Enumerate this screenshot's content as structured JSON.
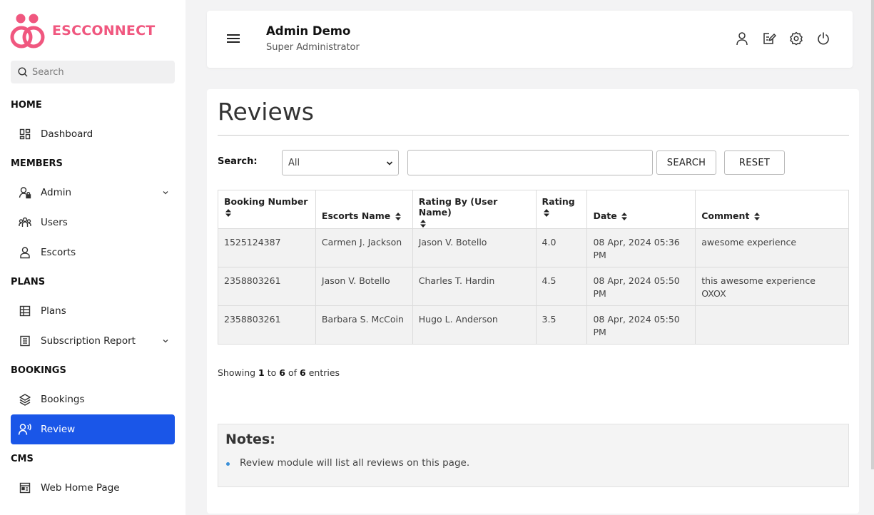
{
  "brand": {
    "name": "ESCCONNECT",
    "color": "#f0577f"
  },
  "sidebar": {
    "search_placeholder": "Search",
    "sections": {
      "home": "HOME",
      "members": "MEMBERS",
      "plans": "PLANS",
      "bookings": "BOOKINGS",
      "cms": "CMS"
    },
    "items": {
      "dashboard": "Dashboard",
      "admin": "Admin",
      "users": "Users",
      "escorts": "Escorts",
      "plans": "Plans",
      "subscription_report": "Subscription Report",
      "bookings": "Bookings",
      "review": "Review",
      "web_home_page": "Web Home Page"
    },
    "active_item": "Review",
    "active_color": "#1a56e8"
  },
  "header": {
    "user_name": "Admin Demo",
    "user_role": "Super Administrator",
    "icons": [
      "user-icon",
      "edit-icon",
      "settings-icon",
      "power-icon"
    ]
  },
  "page": {
    "title": "Reviews",
    "filter": {
      "label": "Search:",
      "select_value": "All",
      "input_value": "",
      "search_button": "SEARCH",
      "reset_button": "RESET"
    },
    "table": {
      "headers": [
        "Booking Number",
        "Escorts Name",
        "Rating By (User Name)",
        "Rating",
        "Date",
        "Comment"
      ],
      "rows": [
        [
          "1525124387",
          "Carmen J. Jackson",
          "Jason V. Botello",
          "4.0",
          "08 Apr, 2024 05:36 PM",
          "awesome experience"
        ],
        [
          "2358803261",
          "Jason V. Botello",
          "Charles T. Hardin",
          "4.5",
          "08 Apr, 2024 05:50 PM",
          "this awesome experience OXOX"
        ],
        [
          "2358803261",
          "Barbara S. McCoin",
          "Hugo L. Anderson",
          "3.5",
          "08 Apr, 2024 05:50 PM",
          ""
        ]
      ]
    },
    "showing": {
      "prefix": "Showing",
      "from": "1",
      "to_word": "to",
      "to": "6",
      "of_word": "of",
      "total": "6",
      "suffix": "entries"
    },
    "notes": {
      "title": "Notes:",
      "items": [
        "Review module will list all reviews on this page."
      ]
    }
  }
}
